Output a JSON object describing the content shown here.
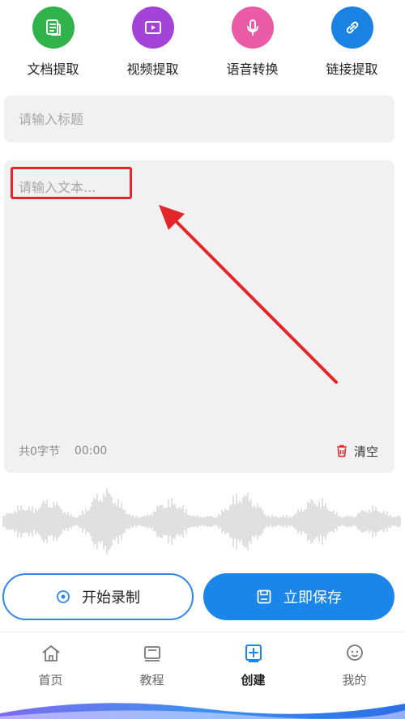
{
  "tools": [
    {
      "label": "文档提取",
      "icon": "document-icon",
      "color": "#2fb34a"
    },
    {
      "label": "视频提取",
      "icon": "video-icon",
      "color": "#a343d8"
    },
    {
      "label": "语音转换",
      "icon": "microphone-icon",
      "color": "#e95ba6"
    },
    {
      "label": "链接提取",
      "icon": "link-icon",
      "color": "#1a82e2"
    }
  ],
  "editor": {
    "title_placeholder": "请输入标题",
    "text_placeholder": "请输入文本...",
    "byte_count": "共0字节",
    "timer": "00:00",
    "clear_label": "清空"
  },
  "actions": {
    "record_label": "开始录制",
    "save_label": "立即保存"
  },
  "nav": {
    "items": [
      {
        "label": "首页",
        "icon": "home-icon"
      },
      {
        "label": "教程",
        "icon": "tutorial-icon"
      },
      {
        "label": "创建",
        "icon": "create-icon",
        "active": true
      },
      {
        "label": "我的",
        "icon": "profile-icon"
      }
    ]
  },
  "colors": {
    "accent": "#1b86ea",
    "highlight": "#e3262b",
    "field_bg": "#f1f1f1"
  }
}
